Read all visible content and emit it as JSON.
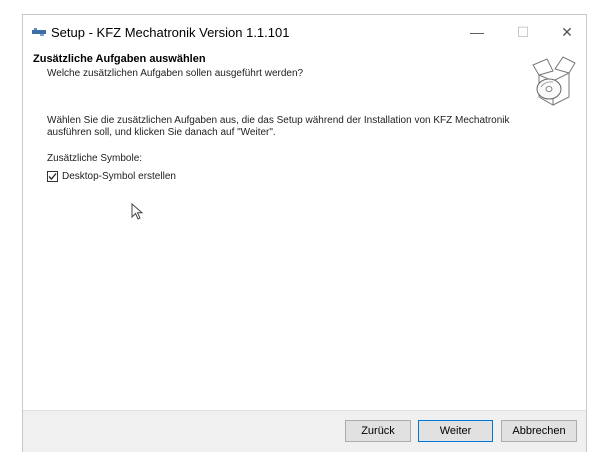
{
  "window": {
    "title": "Setup - KFZ Mechatronik Version 1.1.101",
    "minimize_glyph": "—",
    "maximize_glyph": "☐",
    "close_glyph": "✕"
  },
  "header": {
    "title": "Zusätzliche Aufgaben auswählen",
    "subtitle": "Welche zusätzlichen Aufgaben sollen ausgeführt werden?",
    "icon": "setup-box-icon"
  },
  "content": {
    "intro_line1": "Wählen Sie die zusätzlichen Aufgaben aus, die das Setup während der Installation von KFZ Mechatronik",
    "intro_line2": "ausführen soll, und klicken Sie danach auf \"Weiter\".",
    "group_label": "Zusätzliche Symbole:",
    "tasks": [
      {
        "label": "Desktop-Symbol erstellen",
        "checked": true
      }
    ]
  },
  "buttons": {
    "back": "Zurück",
    "next": "Weiter",
    "cancel": "Abbrechen"
  },
  "colors": {
    "accent": "#0078d7",
    "footer_bg": "#f0f0f0",
    "button_bg": "#e1e1e1"
  }
}
